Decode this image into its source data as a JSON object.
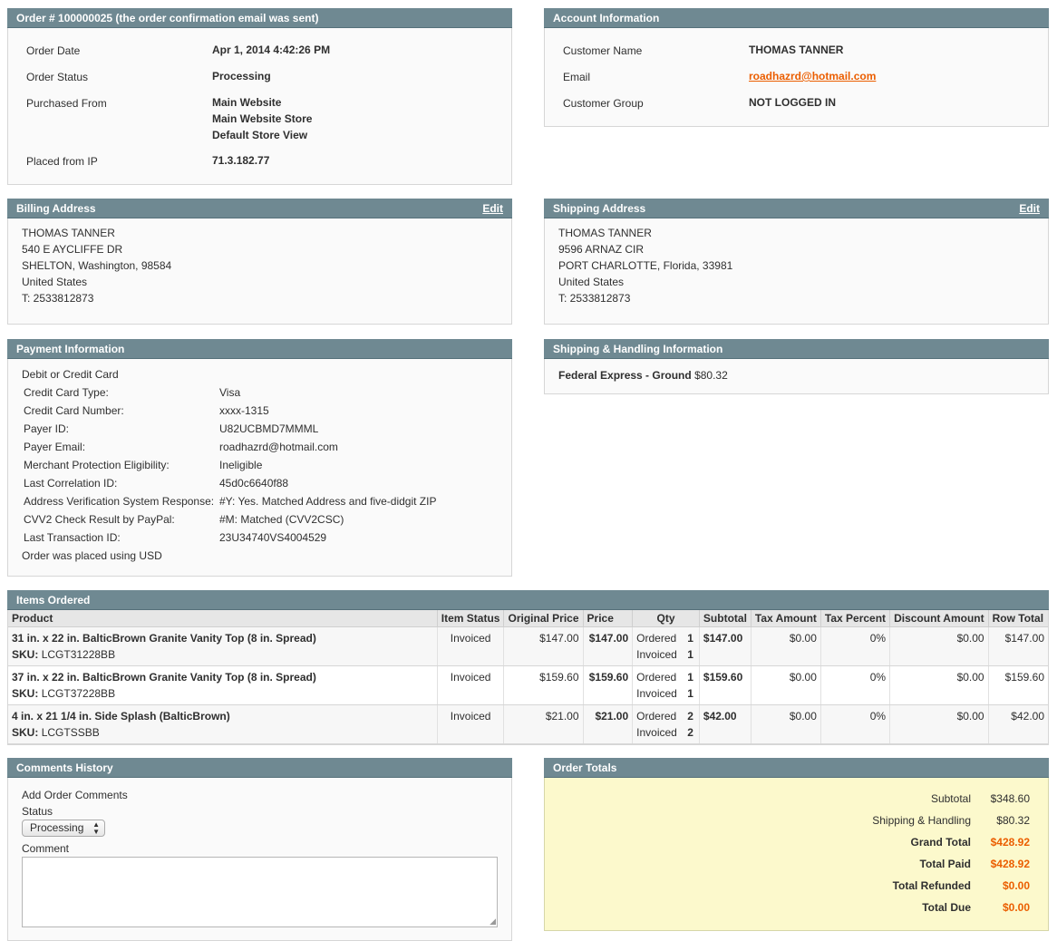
{
  "order": {
    "title": "Order # 100000025 (the order confirmation email was sent)",
    "rows": [
      {
        "label": "Order Date",
        "value": "Apr 1, 2014 4:42:26 PM"
      },
      {
        "label": "Order Status",
        "value": "Processing"
      },
      {
        "label": "Purchased From",
        "value1": "Main Website",
        "value2": "Main Website Store",
        "value3": "Default Store View"
      },
      {
        "label": "Placed from IP",
        "value": "71.3.182.77"
      }
    ]
  },
  "account": {
    "title": "Account Information",
    "rows": [
      {
        "label": "Customer Name",
        "value": "THOMAS TANNER"
      },
      {
        "label": "Email",
        "value": "roadhazrd@hotmail.com"
      },
      {
        "label": "Customer Group",
        "value": "NOT LOGGED IN"
      }
    ]
  },
  "billing": {
    "title": "Billing Address",
    "edit": "Edit",
    "lines": [
      "THOMAS TANNER",
      "540 E AYCLIFFE DR",
      "SHELTON, Washington, 98584",
      "United States",
      "T: 2533812873"
    ]
  },
  "shipping_address": {
    "title": "Shipping Address",
    "edit": "Edit",
    "lines": [
      "THOMAS TANNER",
      "9596 ARNAZ CIR",
      "PORT CHARLOTTE, Florida, 33981",
      "United States",
      "T: 2533812873"
    ]
  },
  "payment": {
    "title": "Payment Information",
    "method": "Debit or Credit Card",
    "rows": [
      {
        "label": "Credit Card Type:",
        "value": "Visa"
      },
      {
        "label": "Credit Card Number:",
        "value": "xxxx-1315"
      },
      {
        "label": "Payer ID:",
        "value": "U82UCBMD7MMML"
      },
      {
        "label": "Payer Email:",
        "value": "roadhazrd@hotmail.com"
      },
      {
        "label": "Merchant Protection Eligibility:",
        "value": "Ineligible"
      },
      {
        "label": "Last Correlation ID:",
        "value": "45d0c6640f88"
      },
      {
        "label": "Address Verification System Response:",
        "value": "#Y: Yes. Matched Address and five-didgit ZIP"
      },
      {
        "label": "CVV2 Check Result by PayPal:",
        "value": "#M: Matched (CVV2CSC)"
      },
      {
        "label": "Last Transaction ID:",
        "value": "23U34740VS4004529"
      }
    ],
    "currency_note": "Order was placed using USD"
  },
  "shipping_handling": {
    "title": "Shipping & Handling Information",
    "method": "Federal Express - Ground",
    "amount": "$80.32"
  },
  "items": {
    "title": "Items Ordered",
    "headers": [
      "Product",
      "Item Status",
      "Original Price",
      "Price",
      "Qty",
      "Subtotal",
      "Tax Amount",
      "Tax Percent",
      "Discount Amount",
      "Row Total"
    ],
    "sku_label": "SKU:",
    "ordered_label": "Ordered",
    "invoiced_label": "Invoiced",
    "rows": [
      {
        "name": "31 in. x 22 in. BalticBrown Granite Vanity Top (8 in. Spread)",
        "sku": "LCGT31228BB",
        "status": "Invoiced",
        "orig": "$147.00",
        "price": "$147.00",
        "ordered": "1",
        "invoiced": "1",
        "subtotal": "$147.00",
        "tax": "$0.00",
        "taxpct": "0%",
        "discount": "$0.00",
        "rowtotal": "$147.00"
      },
      {
        "name": "37 in. x 22 in. BalticBrown Granite Vanity Top (8 in. Spread)",
        "sku": "LCGT37228BB",
        "status": "Invoiced",
        "orig": "$159.60",
        "price": "$159.60",
        "ordered": "1",
        "invoiced": "1",
        "subtotal": "$159.60",
        "tax": "$0.00",
        "taxpct": "0%",
        "discount": "$0.00",
        "rowtotal": "$159.60"
      },
      {
        "name": "4 in. x 21 1/4 in. Side Splash (BalticBrown)",
        "sku": "LCGTSSBB",
        "status": "Invoiced",
        "orig": "$21.00",
        "price": "$21.00",
        "ordered": "2",
        "invoiced": "2",
        "subtotal": "$42.00",
        "tax": "$0.00",
        "taxpct": "0%",
        "discount": "$0.00",
        "rowtotal": "$42.00"
      }
    ]
  },
  "comments": {
    "title": "Comments History",
    "add_label": "Add Order Comments",
    "status_label": "Status",
    "status_value": "Processing",
    "comment_label": "Comment"
  },
  "totals": {
    "title": "Order Totals",
    "rows": [
      {
        "label": "Subtotal",
        "value": "$348.60"
      },
      {
        "label": "Shipping & Handling",
        "value": "$80.32"
      },
      {
        "label": "Grand Total",
        "value": "$428.92"
      },
      {
        "label": "Total Paid",
        "value": "$428.92"
      },
      {
        "label": "Total Refunded",
        "value": "$0.00"
      },
      {
        "label": "Total Due",
        "value": "$0.00"
      }
    ]
  },
  "colors": {
    "header_bg": "#6f8992",
    "accent": "#eb5e00",
    "totals_bg": "#fcf9cc"
  }
}
